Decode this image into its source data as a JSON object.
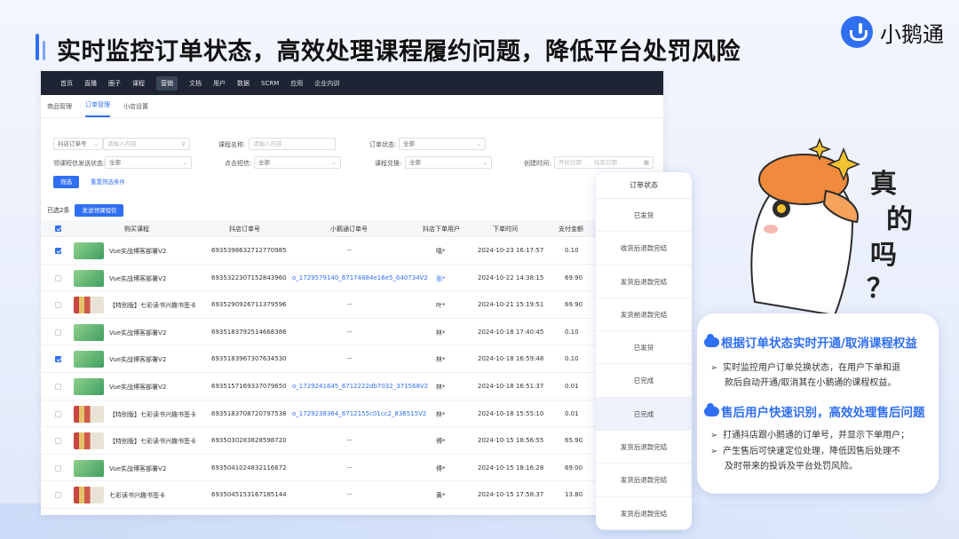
{
  "headline": "实时监控订单状态，高效处理课程履约问题，降低平台处罚风险",
  "logo_text": "小鹅通",
  "nav": [
    "首页",
    "直播",
    "圈子",
    "课程",
    "营销",
    "文档",
    "用户",
    "数据",
    "SCRM",
    "应用",
    "企业内训"
  ],
  "nav_active_index": 4,
  "tabs": [
    "商品管理",
    "订单管理",
    "小店设置"
  ],
  "tab_active_index": 1,
  "filters": {
    "order_type": "抖店订单号",
    "search_placeholder": "请输入内容",
    "course_name_label": "课程名称:",
    "course_name_placeholder": "请输入内容",
    "order_status_label": "订单状态:",
    "order_status_value": "全部",
    "sms_label": "领课短信发送状态:",
    "sms_value": "全部",
    "click_sms_label": "点击短信:",
    "click_sms_value": "全部",
    "redeem_label": "课程兑换:",
    "redeem_value": "全部",
    "created_label": "创建时间:",
    "start_placeholder": "开始日期",
    "end_placeholder": "结束日期",
    "filter_button": "筛选",
    "reset_link": "重置筛选条件"
  },
  "selected_text": "已选2条",
  "send_sms_button": "发送领课短信",
  "columns": [
    "购买课程",
    "抖店订单号",
    "小鹅通订单号",
    "抖店下单用户",
    "下单时间",
    "支付金额"
  ],
  "rows": [
    {
      "checked": true,
      "thumb": "vue",
      "course": "Vue实战博客部署V2",
      "dy_order": "6935398632712770985",
      "xe_order": "--",
      "user": "嘻*",
      "time": "2024-10-23 16:17:57",
      "amount": "0.10"
    },
    {
      "checked": false,
      "thumb": "vue",
      "course": "Vue实战博客部署V2",
      "dy_order": "6935322307152843960",
      "xe_order": "o_1729579140_67174884e16e5_640734V2",
      "user": "张*",
      "time": "2024-10-22 14:38:15",
      "amount": "69.90"
    },
    {
      "checked": false,
      "thumb": "book",
      "course": "【特别版】七彩读书兴趣书签卡",
      "dy_order": "6935290926711379596",
      "xe_order": "--",
      "user": "叶*",
      "time": "2024-10-21 15:19:51",
      "amount": "69.90"
    },
    {
      "checked": false,
      "thumb": "vue",
      "course": "Vue实战博客部署V2",
      "dy_order": "6935183792514668386",
      "xe_order": "--",
      "user": "林*",
      "time": "2024-10-18 17:40:45",
      "amount": "0.10"
    },
    {
      "checked": true,
      "thumb": "vue",
      "course": "Vue实战博客部署V2",
      "dy_order": "6935183967307634530",
      "xe_order": "--",
      "user": "林*",
      "time": "2024-10-18 16:59:48",
      "amount": "0.10"
    },
    {
      "checked": false,
      "thumb": "vue",
      "course": "Vue实战博客部署V2",
      "dy_order": "6935157169337079650",
      "xe_order": "o_1729241645_6712222db7032_371568V2",
      "user": "林*",
      "time": "2024-10-18 16:51:37",
      "amount": "0.01"
    },
    {
      "checked": false,
      "thumb": "book",
      "course": "【特别版】七彩读书兴趣书签卡",
      "dy_order": "6935183708720797538",
      "xe_order": "o_1729238364_6712155c01cc2_836515V2",
      "user": "林*",
      "time": "2024-10-18 15:55:10",
      "amount": "0.01"
    },
    {
      "checked": false,
      "thumb": "book",
      "course": "【特别版】七彩读书兴趣书签卡",
      "dy_order": "6935030283828598720",
      "xe_order": "--",
      "user": "傅*",
      "time": "2024-10-15 18:56:55",
      "amount": "65.90"
    },
    {
      "checked": false,
      "thumb": "vue",
      "course": "Vue实战博客部署V2",
      "dy_order": "6935041024832116672",
      "xe_order": "--",
      "user": "傅*",
      "time": "2024-10-15 18:16:28",
      "amount": "69.00"
    },
    {
      "checked": false,
      "thumb": "book",
      "course": "七彩读书兴趣书签卡",
      "dy_order": "6935045153167185144",
      "xe_order": "--",
      "user": "黄*",
      "time": "2024-10-15 17:58:37",
      "amount": "13.80"
    }
  ],
  "status_column": {
    "header": "订单状态",
    "items": [
      "已发货",
      "收货后退款完结",
      "发货后退款完结",
      "发货前退款完结",
      "已发货",
      "已完成",
      "已完成",
      "发货后退款完结",
      "发货后退款完结",
      "发货后退款完结"
    ],
    "highlight_index": 6
  },
  "card": {
    "title1": "根据订单状态实时开通/取消课程权益",
    "bullet1_line1": "实时监控用户订单兑换状态，在用户下单和退",
    "bullet1_line2": "款后自动开通/取消其在小鹅通的课程权益。",
    "title2": "售后用户快速识别，高效处理售后问题",
    "bullet2": "打通抖店跟小鹅通的订单号，并显示下单用户；",
    "bullet3_line1": "产生售后可快速定位处理，降低因售后处理不",
    "bullet3_line2": "及时带来的投诉及平台处罚风险。"
  },
  "mascot_text": [
    "真",
    "的",
    "吗",
    "？"
  ],
  "colors": {
    "accent": "#2f6ff2",
    "nav_bg": "#1e2433",
    "mascot_hat": "#f08a3c",
    "star": "#f2c230"
  }
}
